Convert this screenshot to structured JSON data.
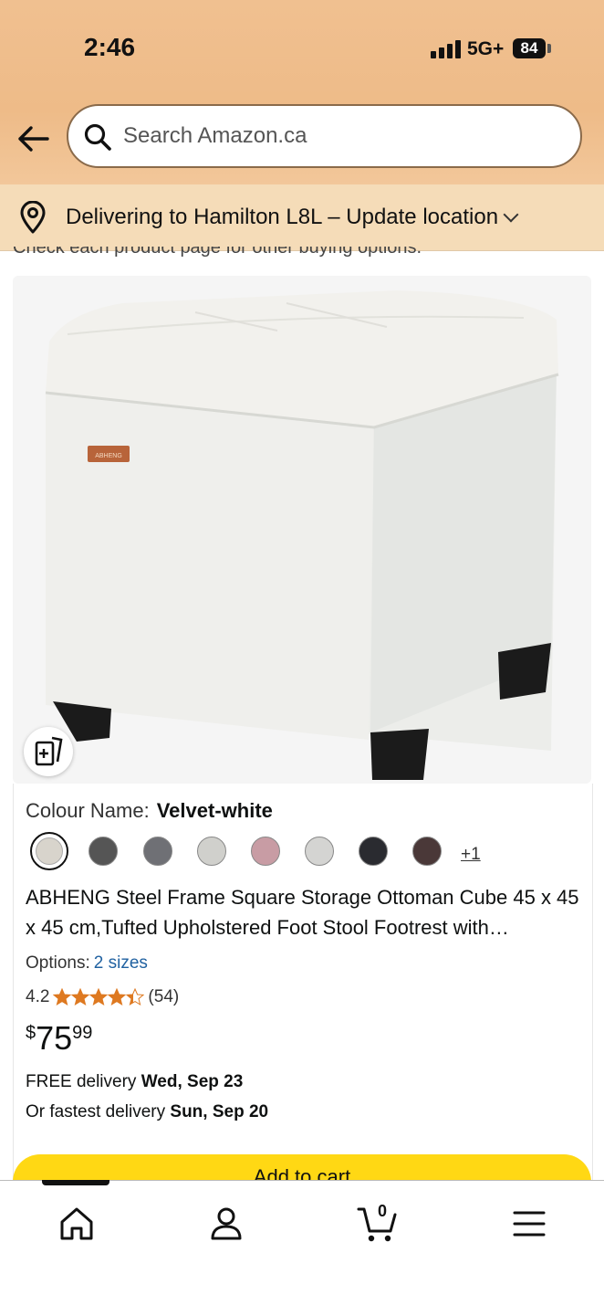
{
  "status_bar": {
    "time": "2:46",
    "network": "5G+",
    "battery": "84"
  },
  "search": {
    "placeholder": "Search Amazon.ca"
  },
  "delivery": {
    "text": "Delivering to Hamilton L8L – Update location"
  },
  "cut_text": "Check each product page for other buying options.",
  "product": {
    "brand_tag": "ABHENG",
    "colour_label": "Colour Name:",
    "colour_value": "Velvet-white",
    "swatches": [
      "#d8d4cc",
      "#555555",
      "#6f7075",
      "#d0d0cc",
      "#c89ca4",
      "#d4d4d2",
      "#2a2b30",
      "#4a3838"
    ],
    "more_colours": "+1",
    "title": "ABHENG Steel Frame Square Storage Ottoman Cube 45 x 45 x 45 cm,Tufted Upholstered Foot Stool Footrest with…",
    "options_label": "Options:",
    "options_link": "2 sizes",
    "rating": "4.2",
    "rating_stars": 4.2,
    "review_count": "(54)",
    "price_symbol": "$",
    "price_whole": "75",
    "price_fraction": "99",
    "free_delivery_label": "FREE delivery",
    "free_delivery_date": "Wed, Sep 23",
    "fastest_label": "Or fastest delivery",
    "fastest_date": "Sun, Sep 20",
    "add_to_cart": "Add to cart"
  },
  "bottom_nav": {
    "cart_count": "0",
    "items": [
      "home-icon",
      "account-icon",
      "cart-icon",
      "menu-icon"
    ]
  },
  "colors": {
    "accent_yellow": "#ffd814",
    "link_blue": "#2162a1",
    "star_orange": "#de7921"
  }
}
